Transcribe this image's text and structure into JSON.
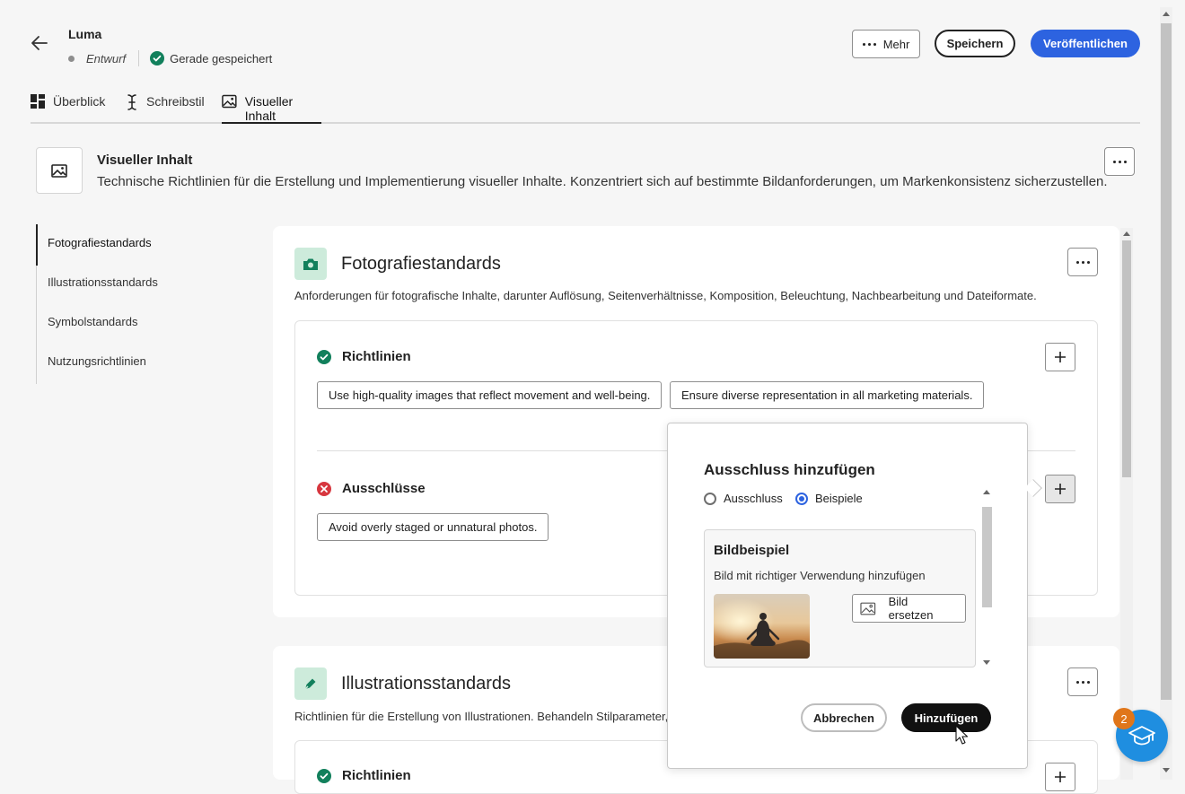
{
  "header": {
    "brand": "Luma",
    "status": "Entwurf",
    "save_status": "Gerade gespeichert",
    "more_label": "Mehr",
    "save_label": "Speichern",
    "publish_label": "Veröffentlichen"
  },
  "tabs": [
    {
      "label": "Überblick",
      "icon": "dashboard-icon"
    },
    {
      "label": "Schreibstil",
      "icon": "text-cursor-icon"
    },
    {
      "label": "Visueller Inhalt",
      "icon": "image-icon",
      "active": true
    }
  ],
  "section": {
    "title": "Visueller Inhalt",
    "description": "Technische Richtlinien für die Erstellung und Implementierung visueller Inhalte. Konzentriert sich auf bestimmte Bildanforderungen, um Markenkonsistenz sicherzustellen."
  },
  "sidenav": {
    "items": [
      {
        "label": "Fotografiestandards",
        "active": true
      },
      {
        "label": "Illustrationsstandards"
      },
      {
        "label": "Symbolstandards"
      },
      {
        "label": "Nutzungsrichtlinien"
      }
    ]
  },
  "photo_card": {
    "title": "Fotografiestandards",
    "description": "Anforderungen für fotografische Inhalte, darunter Auflösung, Seitenverhältnisse, Komposition, Beleuchtung, Nachbearbeitung und Dateiformate.",
    "guidelines_title": "Richtlinien",
    "guidelines": [
      "Use high-quality images that reflect movement and well-being.",
      "Ensure diverse representation in all marketing materials."
    ],
    "exclusions_title": "Ausschlüsse",
    "exclusions": [
      "Avoid overly staged or unnatural photos."
    ]
  },
  "illus_card": {
    "title": "Illustrationsstandards",
    "description": "Richtlinien für die Erstellung von Illustrationen. Behandeln Stilparameter, I",
    "guidelines_title": "Richtlinien"
  },
  "popover": {
    "title": "Ausschluss hinzufügen",
    "radio_exclusion": "Ausschluss",
    "radio_examples": "Beispiele",
    "selected": "Beispiele",
    "image_card_title": "Bildbeispiel",
    "image_card_desc": "Bild mit richtiger Verwendung hinzufügen",
    "replace_label": "Bild ersetzen",
    "cancel_label": "Abbrechen",
    "add_label": "Hinzufügen"
  },
  "help": {
    "badge_count": "2"
  },
  "colors": {
    "primary": "#2d63e0",
    "success": "#12805c",
    "error": "#d7373f",
    "icon_bg": "#cdebdb",
    "badge": "#e0761a",
    "fab": "#1f8ee0"
  }
}
